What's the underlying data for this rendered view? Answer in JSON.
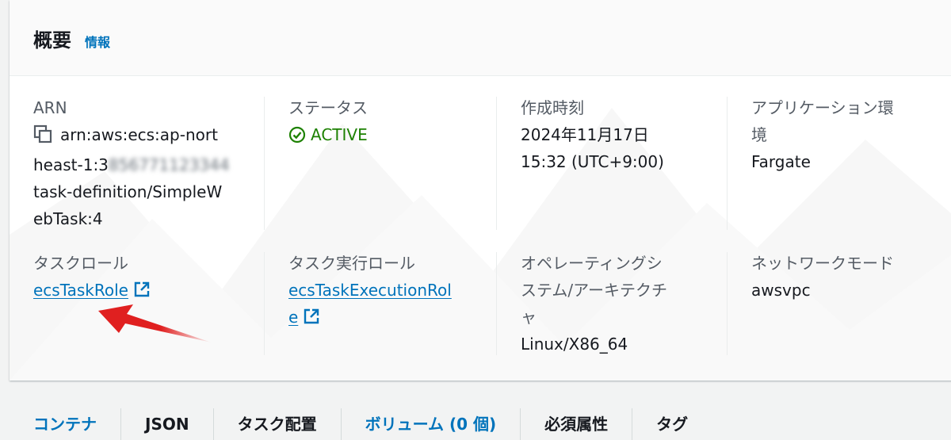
{
  "header": {
    "title": "概要",
    "info_link": "情報"
  },
  "details": {
    "arn": {
      "label": "ARN",
      "line1": "arn:aws:ecs:ap-nort",
      "line2_prefix": "heast-1:3",
      "line2_redacted": "856771123344",
      "line3": "task-definition/SimpleW",
      "line4": "ebTask:4"
    },
    "status": {
      "label": "ステータス",
      "value": "ACTIVE"
    },
    "created": {
      "label": "作成時刻",
      "line1": "2024年11月17日",
      "line2": "15:32 (UTC+9:00)"
    },
    "environment": {
      "label_line1": "アプリケーション環",
      "label_line2": "境",
      "value": "Fargate"
    },
    "task_role": {
      "label": "タスクロール",
      "value": "ecsTaskRole"
    },
    "exec_role": {
      "label": "タスク実行ロール",
      "value_line1": "ecsTaskExecutionRol",
      "value_line2": "e"
    },
    "os_arch": {
      "label_line1": "オペレーティングシ",
      "label_line2": "ステム/アーキテクチ",
      "label_line3": "ャ",
      "value": "Linux/X86_64"
    },
    "network": {
      "label": "ネットワークモード",
      "value": "awsvpc"
    }
  },
  "tabs": [
    {
      "label": "コンテナ"
    },
    {
      "label": "JSON"
    },
    {
      "label": "タスク配置"
    },
    {
      "label": "ボリューム (0 個)"
    },
    {
      "label": "必須属性"
    },
    {
      "label": "タグ"
    }
  ],
  "colors": {
    "link": "#0073bb",
    "status_ok": "#1d8102",
    "annotation_arrow": "#e02020"
  }
}
